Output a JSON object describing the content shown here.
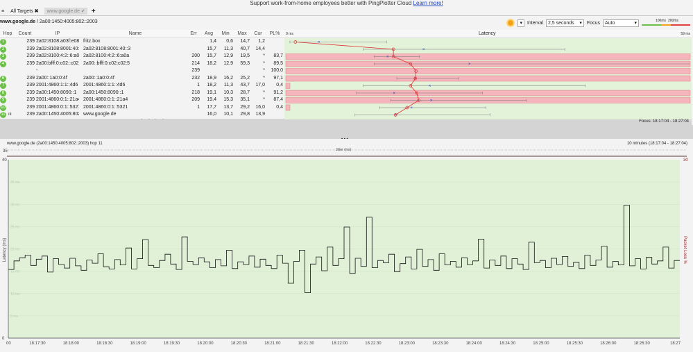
{
  "banner": {
    "text": "Support work-from-home employees better with PingPlotter Cloud",
    "link": "Learn more!"
  },
  "tabs": [
    {
      "label": "All Targets",
      "icon": "close-icon"
    },
    {
      "label": "www.google.de",
      "icon": "check-icon"
    }
  ],
  "breadcrumb": {
    "target": "www.google.de",
    "ip": "/ 2a00:1450:4005:802::2003"
  },
  "toolbar": {
    "interval_label": "Interval",
    "interval": "2,5 seconds",
    "focus_label": "Focus",
    "focus": "Auto",
    "scale_100": "100ms",
    "scale_200": "200ms",
    "colors": {
      "good": "#6cc04a",
      "warn": "#f3a21b",
      "bad": "#e04040"
    }
  },
  "table": {
    "columns": [
      "Hop",
      "Count",
      "IP",
      "Name",
      "Err",
      "Avg",
      "Min",
      "Max",
      "Cur",
      "PL%"
    ],
    "rows": [
      {
        "hop": "1",
        "count": "239",
        "ip": "2a02:8108:a03f:e080::1",
        "name": "fritz.box",
        "err": "",
        "avg": "1,4",
        "min": "0,6",
        "max": "14,7",
        "cur": "1,2",
        "pl": ""
      },
      {
        "hop": "2",
        "count": "239",
        "ip": "2a02:8108:8001:40::3",
        "name": "2a02:8108:8001:40::3",
        "err": "",
        "avg": "15,7",
        "min": "11,3",
        "max": "40,7",
        "cur": "14,4",
        "pl": ""
      },
      {
        "hop": "3",
        "count": "239",
        "ip": "2a02:8100:4:2::6:a0a",
        "name": "2a02:8100:4:2::6:a0a",
        "err": "200",
        "avg": "15,7",
        "min": "12,9",
        "max": "19,5",
        "cur": "*",
        "pl": "83,7"
      },
      {
        "hop": "4",
        "count": "239",
        "ip": "2a00:bfff:0:c02::c02:5",
        "name": "2a00::bfff:0:c02:c02:5",
        "err": "214",
        "avg": "18,2",
        "min": "12,9",
        "max": "59,3",
        "cur": "*",
        "pl": "89,5"
      },
      {
        "hop": "",
        "count": "",
        "ip": "-",
        "name": "",
        "err": "239",
        "avg": "",
        "min": "",
        "max": "",
        "cur": "*",
        "pl": "100,0"
      },
      {
        "hop": "6",
        "count": "239",
        "ip": "2a00::1a0:0:4f",
        "name": "2a00::1a0:0:4f",
        "err": "232",
        "avg": "18,9",
        "min": "16,2",
        "max": "25,2",
        "cur": "*",
        "pl": "97,1"
      },
      {
        "hop": "7",
        "count": "239",
        "ip": "2001:4860:1:1::4d6",
        "name": "2001:4860:1:1::4d6",
        "err": "1",
        "avg": "18,2",
        "min": "11,3",
        "max": "43,7",
        "cur": "17,0",
        "pl": "0,4"
      },
      {
        "hop": "8",
        "count": "239",
        "ip": "2a00:1450:8090::1",
        "name": "2a00:1450:8090::1",
        "err": "218",
        "avg": "19,1",
        "min": "10,3",
        "max": "28,7",
        "cur": "*",
        "pl": "91,2"
      },
      {
        "hop": "9",
        "count": "239",
        "ip": "2001:4860:0:1::21a4",
        "name": "2001:4860:0:1::21a4",
        "err": "209",
        "avg": "19,4",
        "min": "15,3",
        "max": "35,1",
        "cur": "*",
        "pl": "87,4"
      },
      {
        "hop": "10",
        "count": "239",
        "ip": "2001:4860:0:1::5321",
        "name": "2001:4860:0:1::5321",
        "err": "1",
        "avg": "17,7",
        "min": "13,7",
        "max": "29,2",
        "cur": "16,0",
        "pl": "0,4"
      },
      {
        "hop": "11",
        "count": "239",
        "ip": "2a00:1450:4005:802::2003",
        "name": "www.google.de",
        "err": "",
        "avg": "16,0",
        "min": "10,1",
        "max": "29,8",
        "cur": "13,9",
        "pl": ""
      }
    ],
    "round_trip": {
      "count": "239",
      "label": "Round Trip (ms)",
      "avg": "16,0",
      "min": "10,1",
      "max": "29,8",
      "cur": "13,9"
    }
  },
  "latency_graph": {
    "title": "Latency",
    "min_label": "0 ms",
    "max_label": "59 ms",
    "max_ms": 59,
    "focus": "Focus: 18:17:04 - 18:27:04"
  },
  "lower": {
    "title": "www.google.de (2a00:1450:4005:802::2003) hop 11",
    "range": "10 minutes (18:17:04 - 18:27:04)",
    "jitter_label": "Jitter (ms)",
    "jitter_max": "35"
  },
  "chart_data": {
    "type": "line",
    "ylabel": "Latency (ms)",
    "y2label": "Packet Loss %",
    "ylim": [
      0,
      40
    ],
    "y2max": "30",
    "yticks": [
      "40",
      "35 ms",
      "30 ms",
      "25 ms",
      "20 ms",
      "15 ms",
      "10 ms",
      "5 ms",
      "0"
    ],
    "xticks": [
      "00",
      "18:17:30",
      "18:18:00",
      "18:18:30",
      "18:19:00",
      "18:19:30",
      "18:20:00",
      "18:20:30",
      "18:21:00",
      "18:21:30",
      "18:22:00",
      "18:22:30",
      "18:23:00",
      "18:23:30",
      "18:24:00",
      "18:24:30",
      "18:25:00",
      "18:25:30",
      "18:26:00",
      "18:26:30",
      "18:27"
    ],
    "values": [
      15.4,
      17.3,
      18,
      18.6,
      16.3,
      17.7,
      18.4,
      14.8,
      17.8,
      16.5,
      15.7,
      17.9,
      16.2,
      15.2,
      17.5,
      16.8,
      18.9,
      16,
      15.5,
      17.6,
      16.4,
      20.2,
      15.5,
      17.8,
      22.1,
      16.3,
      15.8,
      17.4,
      18.8,
      16.6,
      15.4,
      22.7,
      17.2,
      16.5,
      18,
      17.1,
      15.8,
      17.6,
      16.2,
      19.7,
      15.6,
      17.1,
      16.5,
      18.4,
      15.9,
      17.7,
      16.3,
      15.6,
      18.6,
      16.8,
      12.3,
      17.2,
      19.7,
      10.2,
      16.6,
      18.2,
      15.1,
      20.4,
      16.3,
      17.8,
      24.9,
      14.5,
      17.9,
      16.1,
      27.1,
      15.8,
      17.4,
      16.9,
      18.8,
      14.9,
      16.7,
      18.2,
      15.5,
      19.9,
      16.1,
      17.6,
      15.2,
      18.9,
      16.4,
      17.2,
      15.9,
      18,
      16.5,
      17.3,
      22.2,
      15.7,
      17.5,
      16.3,
      18.4,
      15.6,
      17.8,
      16.6,
      15.4,
      21.5,
      16.9,
      17.4,
      15.8,
      17.9,
      16.5,
      18.3,
      16.1,
      17,
      15.6,
      18.6,
      16.3,
      17.5,
      20.6,
      15.9,
      17.2,
      16.4,
      29.8,
      16.2,
      17.8,
      15.5,
      18.1,
      16.6,
      17.3,
      20.4,
      15.7,
      17.4
    ]
  }
}
